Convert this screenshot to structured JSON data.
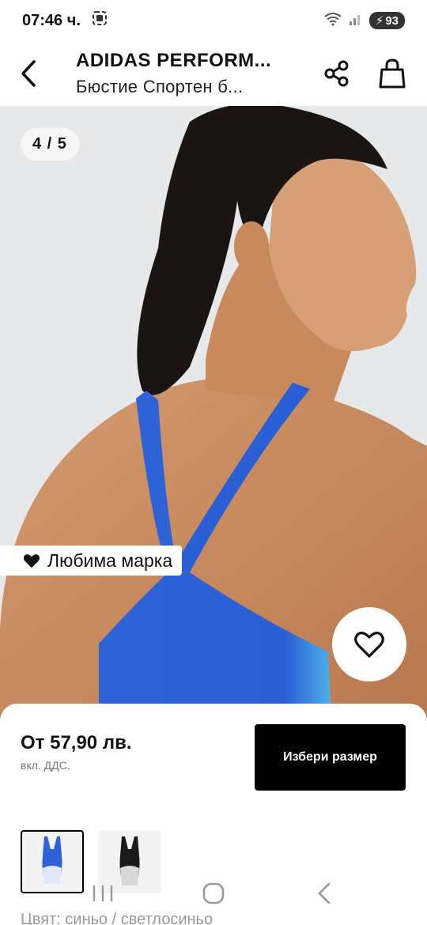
{
  "status_bar": {
    "time": "07:46 ч.",
    "battery": "93"
  },
  "header": {
    "brand": "ADIDAS PERFORM...",
    "product_name": "Бюстие Спортен б..."
  },
  "gallery": {
    "counter": "4 / 5"
  },
  "favorite_brand_label": "Любима марка",
  "purchase": {
    "price": "От 57,90 лв.",
    "vat_note": "вкл. ДДС.",
    "select_size_label": "Избери размер"
  },
  "colors": {
    "selected_label": "Цвят: синьо / светлосиньо"
  },
  "palette": {
    "accent": "#000000",
    "swimsuit_blue": "#2e63d8",
    "light_blue": "#4fb3e8"
  }
}
